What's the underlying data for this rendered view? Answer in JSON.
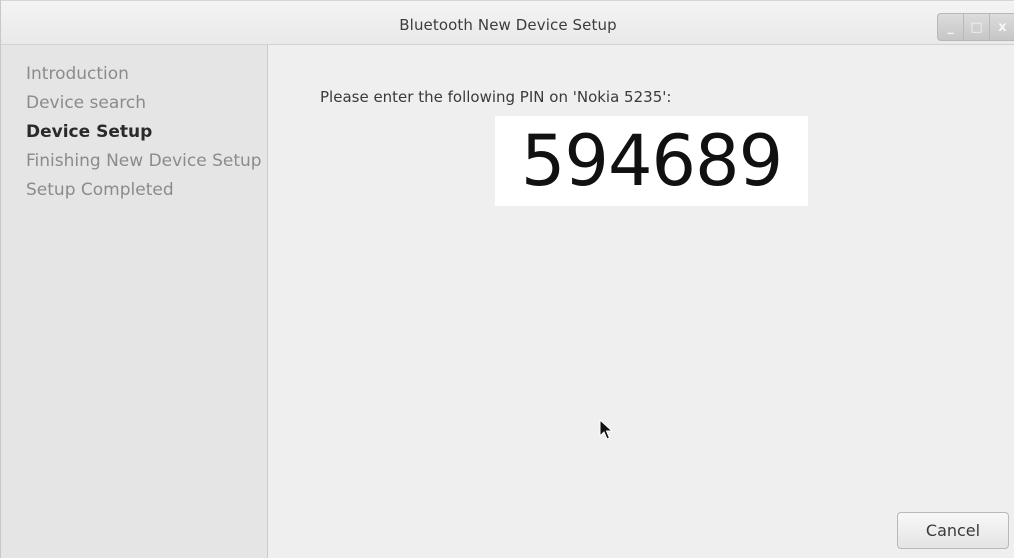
{
  "window": {
    "title": "Bluetooth New Device Setup",
    "controls": {
      "minimize_glyph": "_",
      "maximize_glyph": "□",
      "close_glyph": "x"
    }
  },
  "sidebar": {
    "steps": [
      {
        "label": "Introduction",
        "state": "done"
      },
      {
        "label": "Device search",
        "state": "done"
      },
      {
        "label": "Device Setup",
        "state": "current"
      },
      {
        "label": "Finishing New Device Setup",
        "state": "pending"
      },
      {
        "label": "Setup Completed",
        "state": "pending"
      }
    ]
  },
  "main": {
    "prompt": "Please enter the following PIN on 'Nokia 5235':",
    "pin": "594689"
  },
  "footer": {
    "cancel_label": "Cancel"
  },
  "icons": {
    "cursor": "mouse-pointer-icon"
  }
}
